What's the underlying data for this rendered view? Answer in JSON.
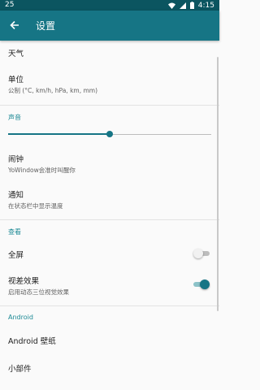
{
  "status_bar": {
    "notification_icon": "25",
    "time": "4:15",
    "icons": [
      "wifi-icon",
      "signal-icon",
      "battery-icon"
    ]
  },
  "app_bar": {
    "back_icon": "arrow-left-icon",
    "title": "设置"
  },
  "items": {
    "weather": {
      "title": "天气"
    },
    "units": {
      "title": "单位",
      "summary": "公制 (°C, km/h, hPa, km, mm)"
    },
    "alarm": {
      "title": "闹钟",
      "summary": "YoWindow会准时叫醒你"
    },
    "notification": {
      "title": "通知",
      "summary": "在状态栏中显示温度"
    },
    "fullscreen": {
      "title": "全屏",
      "enabled": false
    },
    "parallax": {
      "title": "视差效果",
      "summary": "启用动态三位视觉效果",
      "enabled": true
    },
    "wallpaper": {
      "title": "Android 壁纸"
    },
    "widgets": {
      "title": "小部件"
    }
  },
  "sections": {
    "sound": "声音",
    "view": "查看",
    "android": "Android"
  },
  "sound_slider": {
    "value": 0.5
  },
  "colors": {
    "primary": "#167585",
    "primary_dark": "#0b5560",
    "accent": "#1d8a95"
  }
}
